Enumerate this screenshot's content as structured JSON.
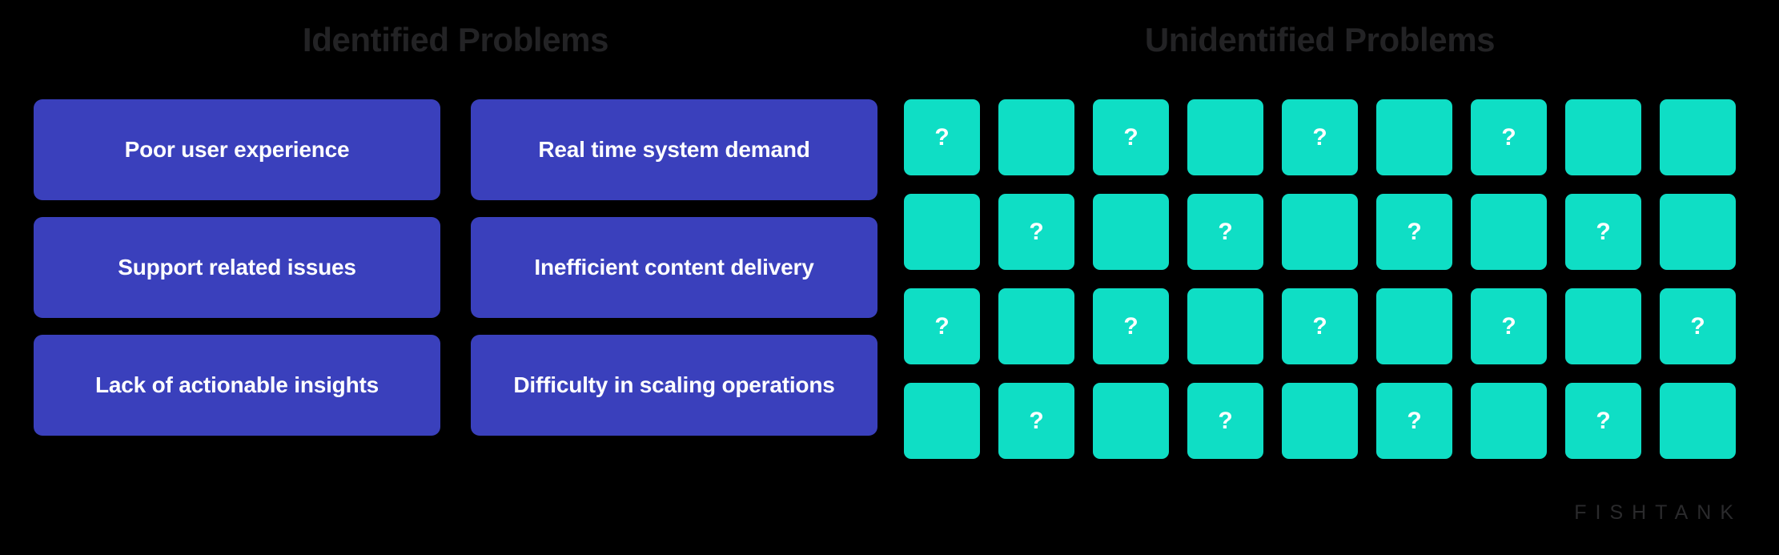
{
  "page": {
    "background_color": "#000000"
  },
  "headings": {
    "identified": "Identified Problems",
    "unidentified": "Unidentified Problems",
    "color": "#232325"
  },
  "identified": {
    "card_color": "#3A40BC",
    "label_color": "#FFFFFF",
    "cards": [
      {
        "label": "Poor user experience"
      },
      {
        "label": "Real time system demand"
      },
      {
        "label": "Support related issues"
      },
      {
        "label": "Inefficient content delivery"
      },
      {
        "label": "Lack of actionable insights"
      },
      {
        "label": "Difficulty in scaling operations"
      }
    ]
  },
  "unidentified": {
    "tile_color": "#0FDEC5",
    "mark_color": "#FFFFFF",
    "mark": "?",
    "columns": 9,
    "rows": 4,
    "tiles": [
      {
        "mark": "?"
      },
      {
        "mark": ""
      },
      {
        "mark": "?"
      },
      {
        "mark": ""
      },
      {
        "mark": "?"
      },
      {
        "mark": ""
      },
      {
        "mark": "?"
      },
      {
        "mark": ""
      },
      {
        "mark": ""
      },
      {
        "mark": ""
      },
      {
        "mark": "?"
      },
      {
        "mark": ""
      },
      {
        "mark": "?"
      },
      {
        "mark": ""
      },
      {
        "mark": "?"
      },
      {
        "mark": ""
      },
      {
        "mark": "?"
      },
      {
        "mark": ""
      },
      {
        "mark": "?"
      },
      {
        "mark": ""
      },
      {
        "mark": "?"
      },
      {
        "mark": ""
      },
      {
        "mark": "?"
      },
      {
        "mark": ""
      },
      {
        "mark": "?"
      },
      {
        "mark": ""
      },
      {
        "mark": "?"
      },
      {
        "mark": ""
      },
      {
        "mark": "?"
      },
      {
        "mark": ""
      },
      {
        "mark": "?"
      },
      {
        "mark": ""
      },
      {
        "mark": "?"
      },
      {
        "mark": ""
      },
      {
        "mark": "?"
      },
      {
        "mark": ""
      }
    ]
  },
  "brand": {
    "wordmark": "FISHTANK",
    "color": "#2A2A2C"
  }
}
